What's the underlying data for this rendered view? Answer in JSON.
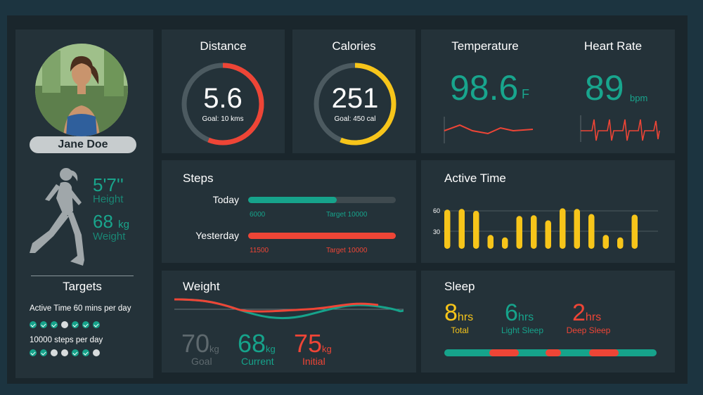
{
  "colors": {
    "teal": "#16a38b",
    "red": "#ee4536",
    "yellow": "#f7c51a",
    "grey": "#4c5a60"
  },
  "profile": {
    "name": "Jane Doe",
    "height_value": "5'7''",
    "height_label": "Height",
    "weight_value": "68",
    "weight_unit": "kg",
    "weight_label": "Weight",
    "targets_title": "Targets",
    "target_items": [
      {
        "label": "Active Time 60 mins per day",
        "dots": [
          true,
          true,
          true,
          false,
          true,
          true,
          true
        ]
      },
      {
        "label": "10000 steps per day",
        "dots": [
          true,
          true,
          false,
          false,
          true,
          true,
          false
        ]
      }
    ]
  },
  "distance": {
    "title": "Distance",
    "value": "5.6",
    "goal": "Goal: 10 kms",
    "progress": 0.56
  },
  "calories": {
    "title": "Calories",
    "value": "251",
    "goal": "Goal: 450 cal",
    "progress": 0.56
  },
  "temperature": {
    "title": "Temperature",
    "value": "98.6",
    "unit": "F"
  },
  "heart_rate": {
    "title": "Heart Rate",
    "value": "89",
    "unit": "bpm"
  },
  "steps": {
    "title": "Steps",
    "rows": [
      {
        "label": "Today",
        "value": "6000",
        "target": "Target 10000",
        "progress": 0.6
      },
      {
        "label": "Yesterday",
        "value": "11500",
        "target": "Target 10000",
        "progress": 1.0
      }
    ]
  },
  "active_time": {
    "title": "Active Time",
    "ticks": [
      "60",
      "30"
    ],
    "values": [
      62,
      63,
      60,
      22,
      18,
      52,
      53,
      45,
      64,
      63,
      55,
      22,
      18,
      54
    ]
  },
  "weight": {
    "title": "Weight",
    "goal_value": "70",
    "goal_label": "Goal",
    "current_value": "68",
    "current_label": "Current",
    "initial_value": "75",
    "initial_label": "Initial",
    "unit": "kg"
  },
  "sleep": {
    "title": "Sleep",
    "total_value": "8",
    "total_label": "Total",
    "light_value": "6",
    "light_label": "Light Sleep",
    "deep_value": "2",
    "deep_label": "Deep Sleep",
    "unit": "hrs"
  }
}
